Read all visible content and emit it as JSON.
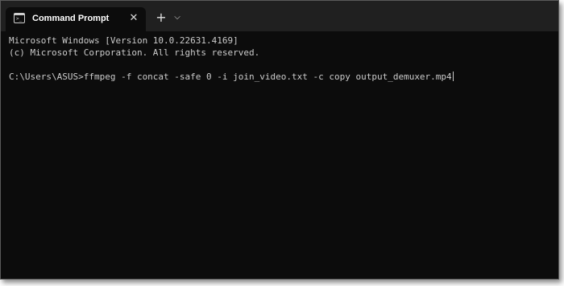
{
  "window": {
    "tab_title": "Command Prompt",
    "tab_close_glyph": "✕",
    "new_tab_glyph": "+",
    "dropdown_glyph": "⌵",
    "tab_icon": "cmd-icon",
    "colors": {
      "titlebar_bg": "#202020",
      "terminal_bg": "#0c0c0c",
      "text": "#cccccc"
    }
  },
  "terminal": {
    "lines": [
      "Microsoft Windows [Version 10.0.22631.4169]",
      "(c) Microsoft Corporation. All rights reserved.",
      "",
      "C:\\Users\\ASUS>ffmpeg -f concat -safe 0 -i join_video.txt -c copy output_demuxer.mp4"
    ]
  }
}
